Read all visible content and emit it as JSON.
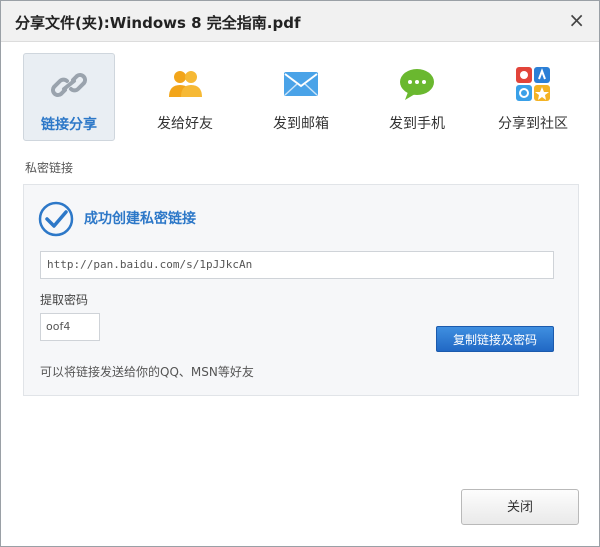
{
  "window": {
    "title": "分享文件(夹):Windows 8 完全指南.pdf",
    "close_glyph": "×"
  },
  "tabs": [
    {
      "label": "链接分享",
      "icon": "link-icon",
      "active": true
    },
    {
      "label": "发给好友",
      "icon": "friends-icon",
      "active": false
    },
    {
      "label": "发到邮箱",
      "icon": "mail-icon",
      "active": false
    },
    {
      "label": "发到手机",
      "icon": "chat-icon",
      "active": false
    },
    {
      "label": "分享到社区",
      "icon": "community-icon",
      "active": false
    }
  ],
  "section_label": "私密链接",
  "panel": {
    "success_text": "成功创建私密链接",
    "link": "http://pan.baidu.com/s/1pJJkcAn",
    "password_label": "提取密码",
    "password": "oof4",
    "copy_button": "复制链接及密码",
    "hint": "可以将链接发送给你的QQ、MSN等好友"
  },
  "footer": {
    "close_button": "关闭"
  },
  "colors": {
    "accent": "#2d78c8",
    "button_blue": "#2168c4",
    "mail_blue": "#4aa3e8",
    "chat_green": "#6ab82f",
    "friends_orange": "#f2a51a"
  }
}
